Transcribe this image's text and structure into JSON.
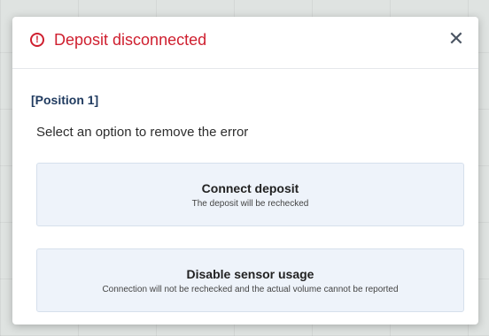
{
  "dialog": {
    "title": "Deposit disconnected",
    "icons": {
      "alert": "alert-circle-icon",
      "close": "close-icon"
    },
    "position_label": "[Position 1]",
    "instruction": "Select an option to remove the error",
    "options": [
      {
        "title": "Connect deposit",
        "description": "The deposit will be rechecked"
      },
      {
        "title": "Disable sensor usage",
        "description": "Connection will not be rechecked and the actual volume cannot be reported"
      }
    ]
  },
  "colors": {
    "error_accent": "#cf1f2f",
    "option_background": "#eef3fa",
    "position_label": "#1f3a5f"
  }
}
